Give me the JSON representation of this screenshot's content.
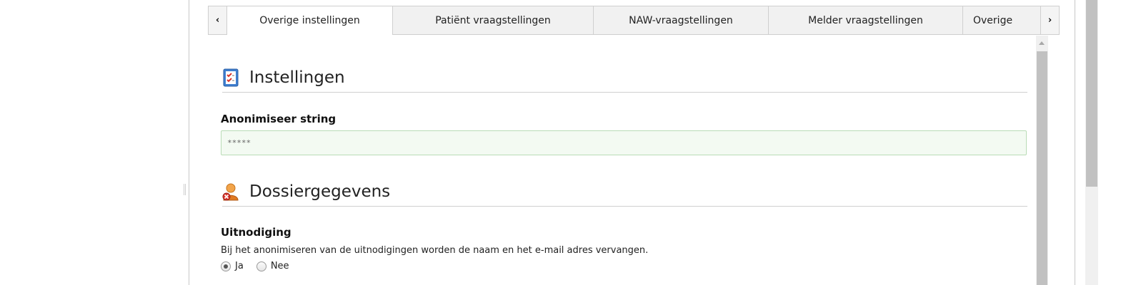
{
  "tabs": {
    "items": [
      {
        "label": "Overige instellingen",
        "active": true
      },
      {
        "label": "Patiënt vraagstellingen",
        "active": false
      },
      {
        "label": "NAW-vraagstellingen",
        "active": false
      },
      {
        "label": "Melder vraagstellingen",
        "active": false
      },
      {
        "label": "Overige",
        "active": false
      }
    ],
    "scroll_left_icon": "chevron-left-icon",
    "scroll_right_icon": "chevron-right-icon"
  },
  "sections": {
    "instellingen": {
      "title": "Instellingen",
      "icon": "checklist-icon",
      "anonimiseer": {
        "label": "Anonimiseer string",
        "value": "*****"
      }
    },
    "dossier": {
      "title": "Dossiergegevens",
      "icon": "user-remove-icon",
      "uitnodiging": {
        "label": "Uitnodiging",
        "description": "Bij het anonimiseren van de uitnodigingen worden de naam en het e-mail adres vervangen.",
        "options": [
          {
            "label": "Ja",
            "checked": true
          },
          {
            "label": "Nee",
            "checked": false
          }
        ]
      }
    }
  },
  "colors": {
    "input_border": "#b9dcb6",
    "input_background": "#f3faf2",
    "tab_background": "#f1f1f1"
  }
}
